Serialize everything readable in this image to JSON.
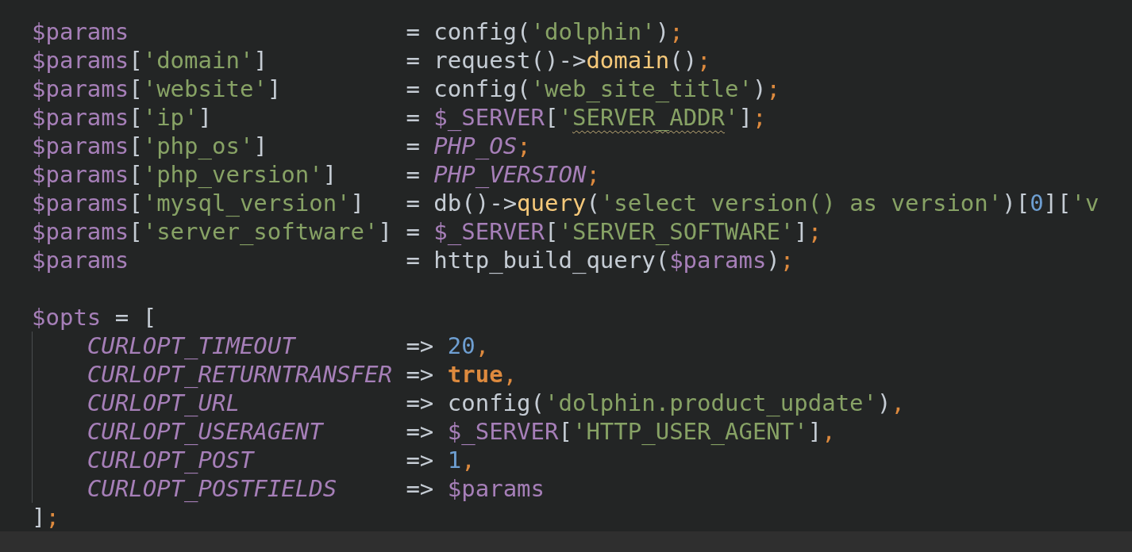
{
  "editor": {
    "lines": [
      {
        "tokens": [
          {
            "kind": "variable",
            "text": "$params"
          },
          {
            "kind": "plain",
            "text": "                    = config("
          },
          {
            "kind": "string",
            "text": "'dolphin'"
          },
          {
            "kind": "plain",
            "text": ")"
          },
          {
            "kind": "punct",
            "text": ";"
          }
        ]
      },
      {
        "tokens": [
          {
            "kind": "variable",
            "text": "$params"
          },
          {
            "kind": "plain",
            "text": "["
          },
          {
            "kind": "string",
            "text": "'domain'"
          },
          {
            "kind": "plain",
            "text": "]          = request()->"
          },
          {
            "kind": "method",
            "text": "domain"
          },
          {
            "kind": "plain",
            "text": "()"
          },
          {
            "kind": "punct",
            "text": ";"
          }
        ]
      },
      {
        "tokens": [
          {
            "kind": "variable",
            "text": "$params"
          },
          {
            "kind": "plain",
            "text": "["
          },
          {
            "kind": "string",
            "text": "'website'"
          },
          {
            "kind": "plain",
            "text": "]         = config("
          },
          {
            "kind": "string",
            "text": "'web_site_title'"
          },
          {
            "kind": "plain",
            "text": ")"
          },
          {
            "kind": "punct",
            "text": ";"
          }
        ]
      },
      {
        "tokens": [
          {
            "kind": "variable",
            "text": "$params"
          },
          {
            "kind": "plain",
            "text": "["
          },
          {
            "kind": "string",
            "text": "'ip'"
          },
          {
            "kind": "plain",
            "text": "]              = "
          },
          {
            "kind": "variable",
            "text": "$_SERVER"
          },
          {
            "kind": "plain",
            "text": "["
          },
          {
            "kind": "string",
            "text": "'"
          },
          {
            "kind": "string",
            "text": "SERVER_ADDR",
            "flagged": true
          },
          {
            "kind": "string",
            "text": "'"
          },
          {
            "kind": "plain",
            "text": "]"
          },
          {
            "kind": "punct",
            "text": ";"
          }
        ]
      },
      {
        "tokens": [
          {
            "kind": "variable",
            "text": "$params"
          },
          {
            "kind": "plain",
            "text": "["
          },
          {
            "kind": "string",
            "text": "'php_os'"
          },
          {
            "kind": "plain",
            "text": "]          = "
          },
          {
            "kind": "constant",
            "text": "PHP_OS"
          },
          {
            "kind": "punct",
            "text": ";"
          }
        ]
      },
      {
        "tokens": [
          {
            "kind": "variable",
            "text": "$params"
          },
          {
            "kind": "plain",
            "text": "["
          },
          {
            "kind": "string",
            "text": "'php_version'"
          },
          {
            "kind": "plain",
            "text": "]     = "
          },
          {
            "kind": "constant",
            "text": "PHP_VERSION"
          },
          {
            "kind": "punct",
            "text": ";"
          }
        ]
      },
      {
        "tokens": [
          {
            "kind": "variable",
            "text": "$params"
          },
          {
            "kind": "plain",
            "text": "["
          },
          {
            "kind": "string",
            "text": "'mysql_version'"
          },
          {
            "kind": "plain",
            "text": "]   = db()->"
          },
          {
            "kind": "method",
            "text": "query"
          },
          {
            "kind": "plain",
            "text": "("
          },
          {
            "kind": "string",
            "text": "'select version() as version'"
          },
          {
            "kind": "plain",
            "text": ")["
          },
          {
            "kind": "number",
            "text": "0"
          },
          {
            "kind": "plain",
            "text": "]["
          },
          {
            "kind": "string",
            "text": "'v"
          }
        ]
      },
      {
        "tokens": [
          {
            "kind": "variable",
            "text": "$params"
          },
          {
            "kind": "plain",
            "text": "["
          },
          {
            "kind": "string",
            "text": "'server_software'"
          },
          {
            "kind": "plain",
            "text": "] = "
          },
          {
            "kind": "variable",
            "text": "$_SERVER"
          },
          {
            "kind": "plain",
            "text": "["
          },
          {
            "kind": "string",
            "text": "'SERVER_SOFTWARE'"
          },
          {
            "kind": "plain",
            "text": "]"
          },
          {
            "kind": "punct",
            "text": ";"
          }
        ]
      },
      {
        "tokens": [
          {
            "kind": "variable",
            "text": "$params"
          },
          {
            "kind": "plain",
            "text": "                    = http_build_query("
          },
          {
            "kind": "variable",
            "text": "$params"
          },
          {
            "kind": "plain",
            "text": ")"
          },
          {
            "kind": "punct",
            "text": ";"
          }
        ]
      },
      {
        "kind": "blank"
      },
      {
        "tokens": [
          {
            "kind": "variable",
            "text": "$opts"
          },
          {
            "kind": "plain",
            "text": " = ["
          }
        ],
        "children": [
          {
            "tokens": [
              {
                "kind": "constant",
                "text": "CURLOPT_TIMEOUT"
              },
              {
                "kind": "plain",
                "text": "        => "
              },
              {
                "kind": "number",
                "text": "20"
              },
              {
                "kind": "punct",
                "text": ","
              }
            ]
          },
          {
            "tokens": [
              {
                "kind": "constant",
                "text": "CURLOPT_RETURNTRANSFER"
              },
              {
                "kind": "plain",
                "text": " => "
              },
              {
                "kind": "keyword",
                "text": "true"
              },
              {
                "kind": "punct",
                "text": ","
              }
            ]
          },
          {
            "tokens": [
              {
                "kind": "constant",
                "text": "CURLOPT_URL"
              },
              {
                "kind": "plain",
                "text": "            => config("
              },
              {
                "kind": "string",
                "text": "'dolphin.product_update'"
              },
              {
                "kind": "plain",
                "text": ")"
              },
              {
                "kind": "punct",
                "text": ","
              }
            ]
          },
          {
            "tokens": [
              {
                "kind": "constant",
                "text": "CURLOPT_USERAGENT"
              },
              {
                "kind": "plain",
                "text": "      => "
              },
              {
                "kind": "variable",
                "text": "$_SERVER"
              },
              {
                "kind": "plain",
                "text": "["
              },
              {
                "kind": "string",
                "text": "'HTTP_USER_AGENT'"
              },
              {
                "kind": "plain",
                "text": "]"
              },
              {
                "kind": "punct",
                "text": ","
              }
            ]
          },
          {
            "tokens": [
              {
                "kind": "constant",
                "text": "CURLOPT_POST"
              },
              {
                "kind": "plain",
                "text": "           => "
              },
              {
                "kind": "number",
                "text": "1"
              },
              {
                "kind": "punct",
                "text": ","
              }
            ]
          },
          {
            "tokens": [
              {
                "kind": "constant",
                "text": "CURLOPT_POSTFIELDS"
              },
              {
                "kind": "plain",
                "text": "     => "
              },
              {
                "kind": "variable",
                "text": "$params"
              }
            ]
          }
        ]
      },
      {
        "tokens": [
          {
            "kind": "plain",
            "text": "]"
          },
          {
            "kind": "punct",
            "text": ";"
          }
        ]
      }
    ]
  }
}
